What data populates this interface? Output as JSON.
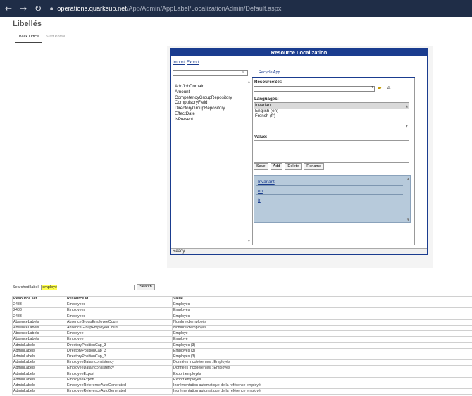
{
  "browser": {
    "url_host": "operations.quarksup.net",
    "url_path": "/App/Admin/AppLabel/LocalizationAdmin/Default.aspx"
  },
  "page": {
    "title": "Libellés",
    "tabs": [
      {
        "label": "Back Office",
        "active": true
      },
      {
        "label": "Staff Portal",
        "active": false
      }
    ]
  },
  "localization": {
    "header": "Resource Localization",
    "import_label": "Import",
    "export_label": "Export",
    "recycle_label": "Recycle App",
    "resource_items": [
      "AddJobDomain",
      "Amount",
      "CompetencyGroupRepository",
      "CompulsoryField",
      "DirectoryGroupRepository",
      "EffectDate",
      "IsPresent"
    ],
    "resourceset_label": "ResourceSet:",
    "languages_label": "Languages:",
    "languages": [
      {
        "label": "Invariant",
        "selected": true
      },
      {
        "label": "English (en)",
        "selected": false
      },
      {
        "label": "French (fr)",
        "selected": false
      }
    ],
    "value_label": "Value:",
    "buttons": {
      "save": "Save",
      "add": "Add",
      "delete": "Delete",
      "rename": "Rename"
    },
    "translations": [
      {
        "lang": "Invariant",
        "suffix": ":"
      },
      {
        "lang": "en",
        "suffix": ":"
      },
      {
        "lang": "fr",
        "suffix": ":"
      }
    ],
    "status": "Ready"
  },
  "search": {
    "label": "Searched label:",
    "value": "employé",
    "button": "Search"
  },
  "results": {
    "headers": [
      "Resource set",
      "Resource id",
      "Value"
    ],
    "rows": [
      [
        "2483",
        "Employees",
        "Employés"
      ],
      [
        "2483",
        "Employees",
        "Employés"
      ],
      [
        "2483",
        "Employees",
        "Employés"
      ],
      [
        "AbsenceLabels",
        "AbsenceGroupEmployeeCount",
        "Nombre d'employés"
      ],
      [
        "AbsenceLabels",
        "AbsenceGroupEmployeeCount",
        "Nombre d'employés"
      ],
      [
        "AbsenceLabels",
        "Employee",
        "Employé"
      ],
      [
        "AbsenceLabels",
        "Employee",
        "Employé"
      ],
      [
        "AdminLabels",
        "DirectoryPositionCap_3",
        "Employés (3)"
      ],
      [
        "AdminLabels",
        "DirectoryPositionCap_3",
        "Employés (3)"
      ],
      [
        "AdminLabels",
        "DirectoryPositionCap_3",
        "Employés (3)"
      ],
      [
        "AdminLabels",
        "EmployeeDataInconsistency",
        "Données incohérentes : Employés"
      ],
      [
        "AdminLabels",
        "EmployeeDataInconsistency",
        "Données incohérentes : Employés"
      ],
      [
        "AdminLabels",
        "EmployeeExport",
        "Export employés"
      ],
      [
        "AdminLabels",
        "EmployeeExport",
        "Export employés"
      ],
      [
        "AdminLabels",
        "EmployeeReferenceAutoGenerated",
        "Incrémentation automatique de la référence employé"
      ],
      [
        "AdminLabels",
        "EmployeeReferenceAutoGenerated",
        "Incrémentation automatique de la référence employé"
      ]
    ]
  }
}
